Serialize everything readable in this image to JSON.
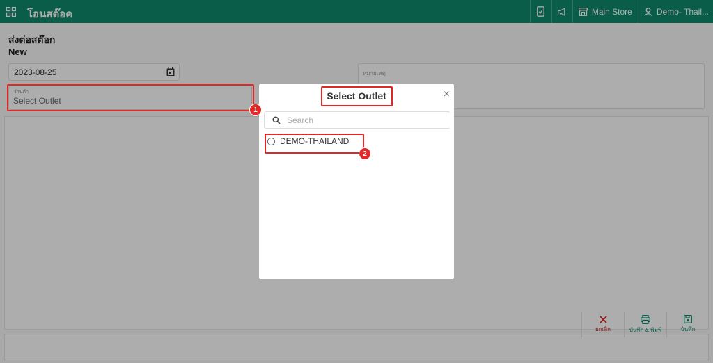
{
  "topbar": {
    "app_title": "โอนสต๊อค",
    "store_label": "Main Store",
    "user_label": "Demo- Thail...",
    "icons": [
      "apps-grid-icon",
      "mobile-icon",
      "megaphone-icon",
      "store-icon",
      "user-icon"
    ],
    "bg_color": "#0e8a6c"
  },
  "page": {
    "title": "ส่งต่อสต๊อก",
    "subtitle": "New",
    "date_value": "2023-08-25",
    "outlet_label": "ร้านค้า",
    "outlet_value": "Select Outlet",
    "note_placeholder": "หมายเหตุ"
  },
  "footer": {
    "cancel_label": "ยกเลิก",
    "save_print_label": "บันทึก & พิมพ์",
    "save_label": "บันทึก"
  },
  "modal": {
    "title": "Select Outlet",
    "close": "×",
    "search_placeholder": "Search",
    "options": [
      {
        "label": "DEMO-THAILAND",
        "selected": false
      }
    ]
  },
  "annotations": {
    "badge1": "1",
    "badge2": "2",
    "color": "#e32626"
  }
}
